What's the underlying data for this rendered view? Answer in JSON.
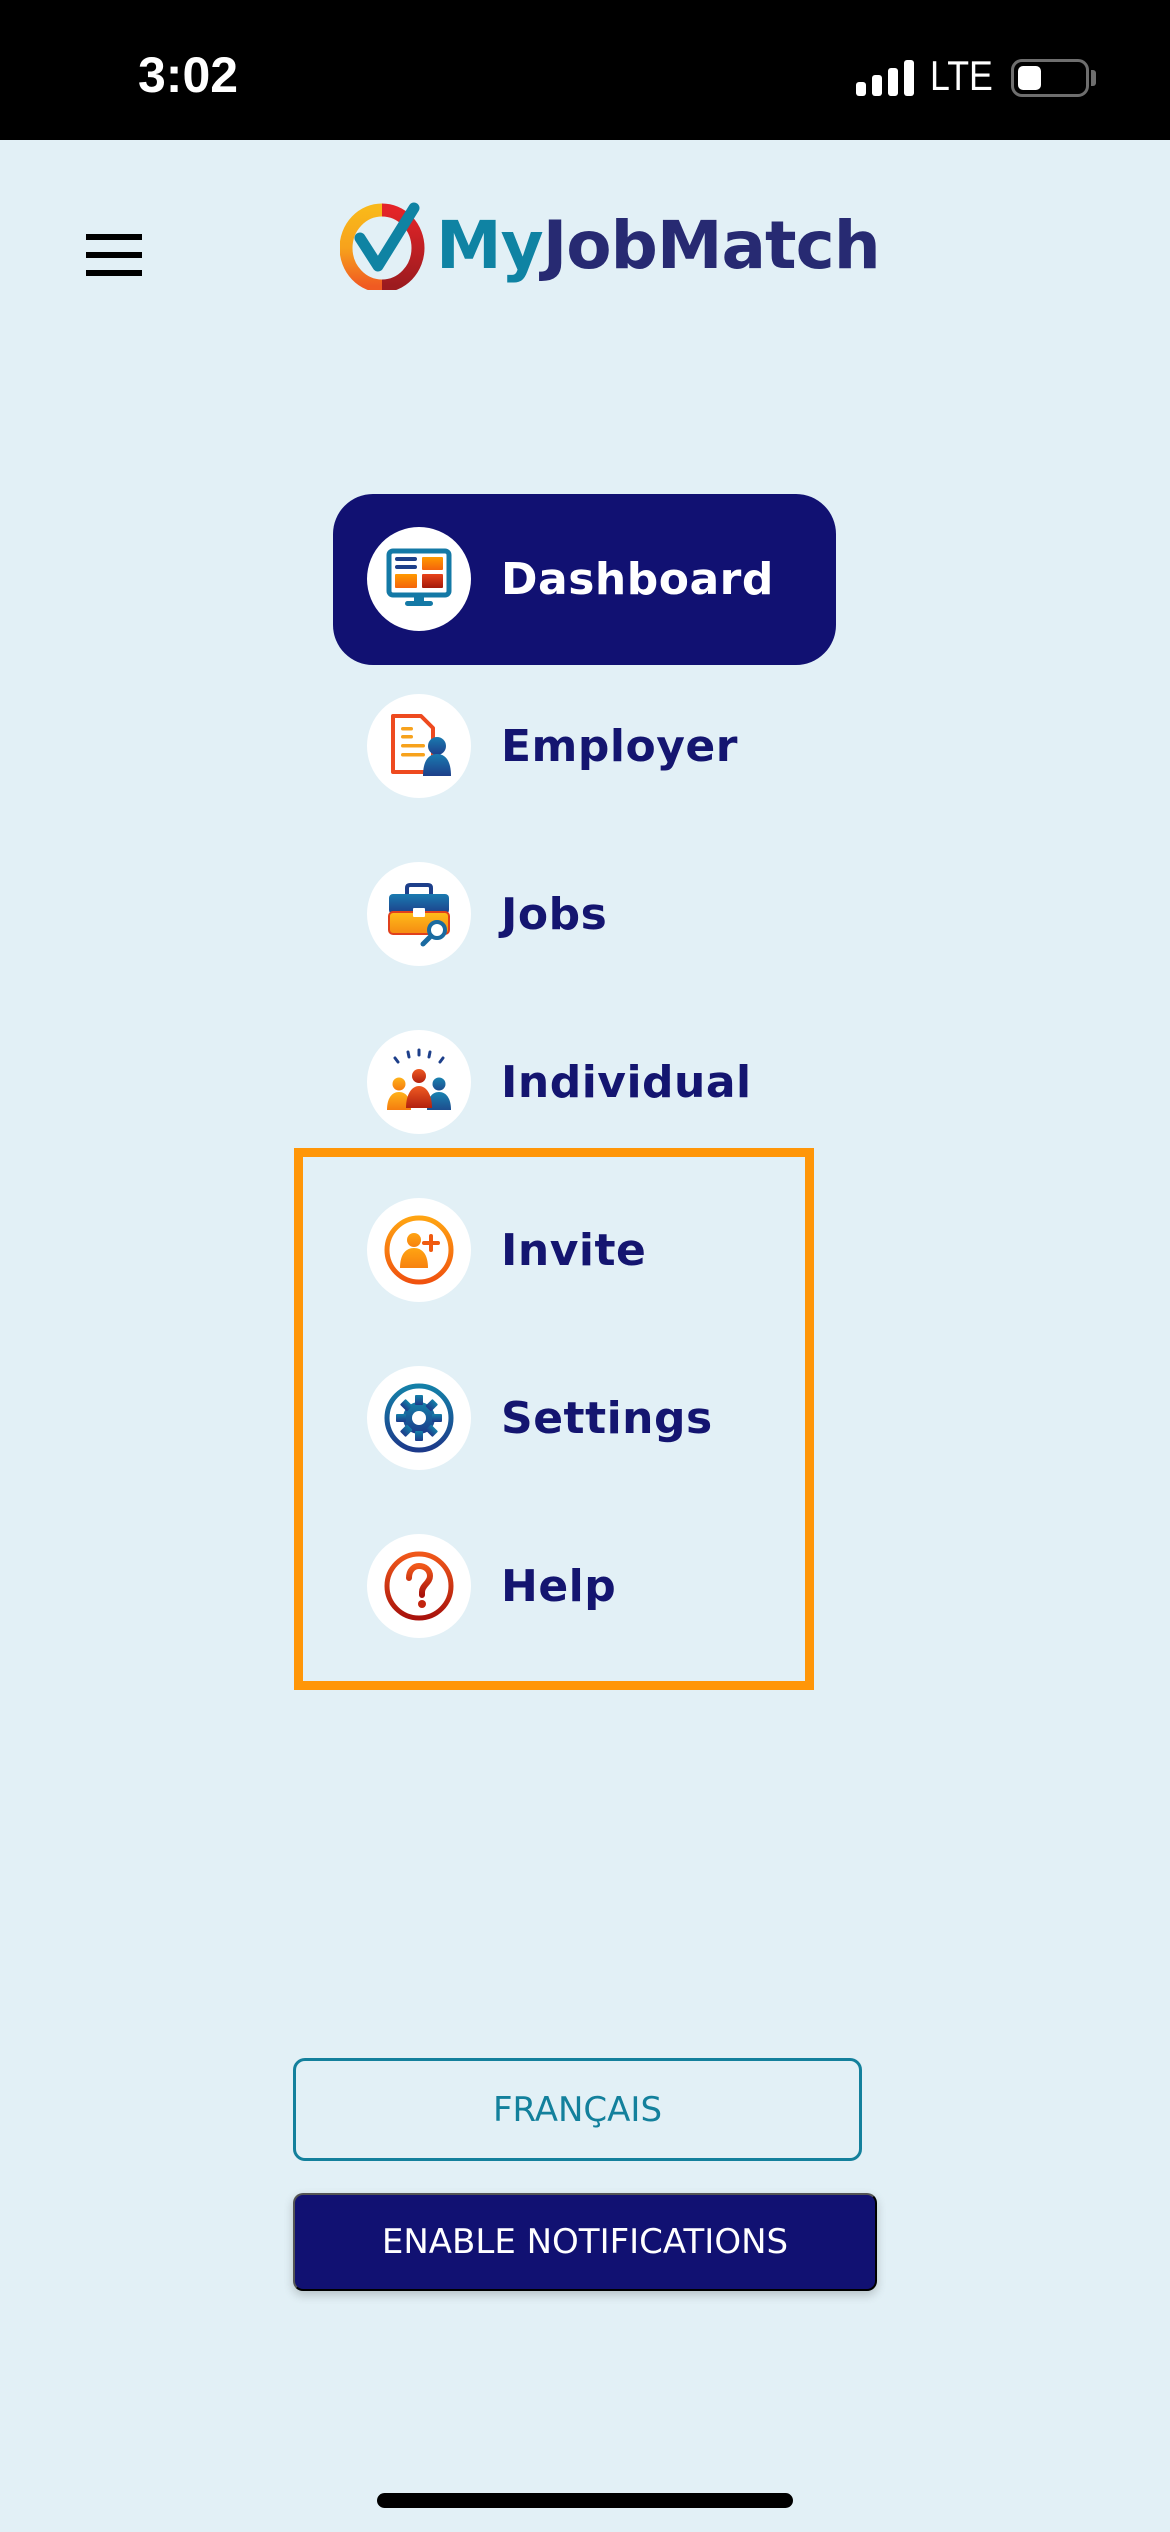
{
  "status_bar": {
    "time": "3:02",
    "network": "LTE",
    "signal_bars": 4,
    "battery_level": 0.35
  },
  "header": {
    "menu_icon": "hamburger-icon",
    "logo": {
      "part1": "My",
      "part2": "JobMatch",
      "icon": "checkmark-ring-logo"
    }
  },
  "menu": {
    "items": [
      {
        "label": "Dashboard",
        "icon": "monitor-dashboard-icon",
        "active": true
      },
      {
        "label": "Employer",
        "icon": "document-person-icon",
        "active": false
      },
      {
        "label": "Jobs",
        "icon": "briefcase-search-icon",
        "active": false
      },
      {
        "label": "Individual",
        "icon": "people-group-icon",
        "active": false
      },
      {
        "label": "Invite",
        "icon": "person-add-icon",
        "active": false
      },
      {
        "label": "Settings",
        "icon": "gear-icon",
        "active": false
      },
      {
        "label": "Help",
        "icon": "question-circle-icon",
        "active": false
      }
    ],
    "highlighted_items": [
      "Invite",
      "Settings",
      "Help"
    ]
  },
  "buttons": {
    "language": "FRANÇAIS",
    "notifications": "ENABLE NOTIFICATIONS"
  },
  "colors": {
    "background": "#e2f0f6",
    "primary_navy": "#111172",
    "teal": "#13809c",
    "highlight_orange": "#ff9608",
    "label_navy": "#141570"
  }
}
